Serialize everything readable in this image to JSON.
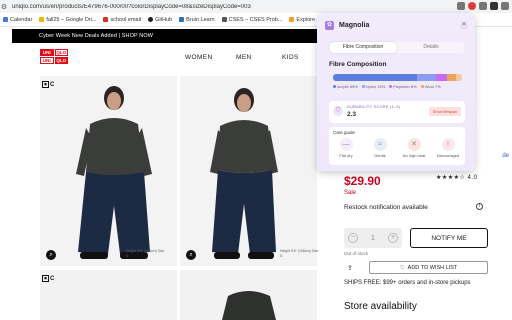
{
  "browser": {
    "url": "uniqlo.com/us/en/products/E479676-000/00?colorDisplayCode=08&sizeDisplayCode=003",
    "bookmarks": [
      "Calendar",
      "fall25 – Google Dri...",
      "school email",
      "GitHub",
      "Bruin Learn",
      "CSES – CSES Prob...",
      "Explore – LeetCo..."
    ]
  },
  "promo": {
    "text": "Cyber Week New Deals Added | SHOP NOW"
  },
  "site": {
    "logo": [
      "UNI",
      "QLO",
      "UNI",
      "QLO"
    ],
    "nav": [
      "WOMEN",
      "MEN",
      "KIDS"
    ]
  },
  "images": {
    "badge_text": "C",
    "caption": "Height 5'6\" (168cm) Size S"
  },
  "product": {
    "rating_link": "de",
    "stars": "★★★★☆ 4.0",
    "price": "$29.90",
    "sale_label": "Sale",
    "restock": "Restock notification available",
    "qty_minus": "−",
    "qty_value": "1",
    "qty_plus": "+",
    "notify_label": "NOTIFY ME",
    "out_of_stock": "Out of stock",
    "wishlist_label": "ADD TO WISH LIST",
    "shipping": "SHIPS FREE: $99+ orders and in-store pickups",
    "store_availability": "Store availability"
  },
  "popup": {
    "app_name": "Magnolia",
    "tabs": [
      "Fibre Composition",
      "Details"
    ],
    "section_title": "Fibre Composition",
    "fibres": [
      {
        "label": "Acrylic 65%",
        "value": 65,
        "color": "#5b7fe0"
      },
      {
        "label": "Nylon 15%",
        "value": 15,
        "color": "#8c9cf0"
      },
      {
        "label": "Polyester 8%",
        "value": 8,
        "color": "#c56cf0"
      },
      {
        "label": "Wool 7%",
        "value": 7,
        "color": "#f0a35c"
      },
      {
        "label": "",
        "value": 5,
        "color": "#f2c9a4"
      }
    ],
    "durability_label": "DURABILITY SCORE (1–5)",
    "durability_value": "2.3",
    "durability_badge": "Short lifespan",
    "care_title": "Care guide",
    "care": [
      {
        "label": "Flat dry",
        "icon": "—",
        "color": "#f3ecf9"
      },
      {
        "label": "Gentle",
        "icon": "≈",
        "color": "#e7edfb"
      },
      {
        "label": "No high heat",
        "icon": "✕",
        "color": "#fce3e3"
      },
      {
        "label": "Discouraged",
        "icon": "!",
        "color": "#fbe6ee"
      }
    ]
  }
}
